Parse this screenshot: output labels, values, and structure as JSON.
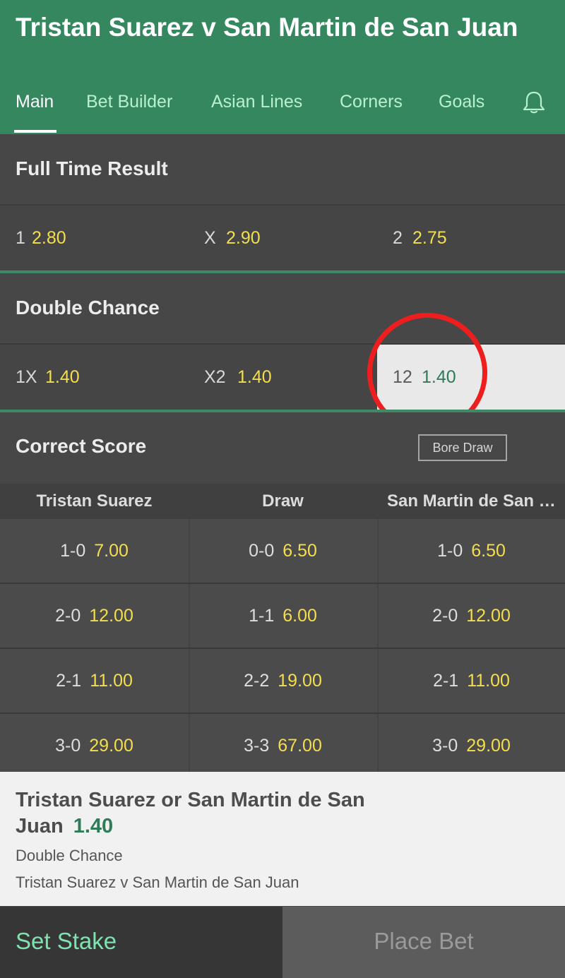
{
  "header": {
    "title": "Tristan Suarez v San Martin de San Juan",
    "tabs": [
      {
        "label": "Main",
        "active": true
      },
      {
        "label": "Bet Builder",
        "active": false
      },
      {
        "label": "Asian Lines",
        "active": false
      },
      {
        "label": "Corners",
        "active": false
      },
      {
        "label": "Goals",
        "active": false
      }
    ],
    "bell_icon": "bell-icon"
  },
  "full_time_result": {
    "title": "Full Time Result",
    "selections": [
      {
        "label": "1",
        "odds": "2.80"
      },
      {
        "label": "X",
        "odds": "2.90"
      },
      {
        "label": "2",
        "odds": "2.75"
      }
    ]
  },
  "double_chance": {
    "title": "Double Chance",
    "selections": [
      {
        "label": "1X",
        "odds": "1.40",
        "selected": false
      },
      {
        "label": "X2",
        "odds": "1.40",
        "selected": false
      },
      {
        "label": "12",
        "odds": "1.40",
        "selected": true
      }
    ]
  },
  "correct_score": {
    "title": "Correct Score",
    "toggle_label": "Bore Draw",
    "columns": [
      "Tristan Suarez",
      "Draw",
      "San Martin de San Juan"
    ],
    "rows": [
      [
        {
          "score": "1-0",
          "odds": "7.00"
        },
        {
          "score": "0-0",
          "odds": "6.50"
        },
        {
          "score": "1-0",
          "odds": "6.50"
        }
      ],
      [
        {
          "score": "2-0",
          "odds": "12.00"
        },
        {
          "score": "1-1",
          "odds": "6.00"
        },
        {
          "score": "2-0",
          "odds": "12.00"
        }
      ],
      [
        {
          "score": "2-1",
          "odds": "11.00"
        },
        {
          "score": "2-2",
          "odds": "19.00"
        },
        {
          "score": "2-1",
          "odds": "11.00"
        }
      ],
      [
        {
          "score": "3-0",
          "odds": "29.00"
        },
        {
          "score": "3-3",
          "odds": "67.00"
        },
        {
          "score": "3-0",
          "odds": "29.00"
        }
      ]
    ]
  },
  "betslip": {
    "selection": "Tristan Suarez or San Martin de San Juan",
    "price": "1.40",
    "market": "Double Chance",
    "event": "Tristan Suarez v San Martin de San Juan",
    "set_stake_label": "Set Stake",
    "place_bet_label": "Place Bet"
  },
  "colors": {
    "brand_green": "#35875f",
    "odds_yellow": "#f4de4e",
    "highlight_red": "#ee1e1e"
  }
}
